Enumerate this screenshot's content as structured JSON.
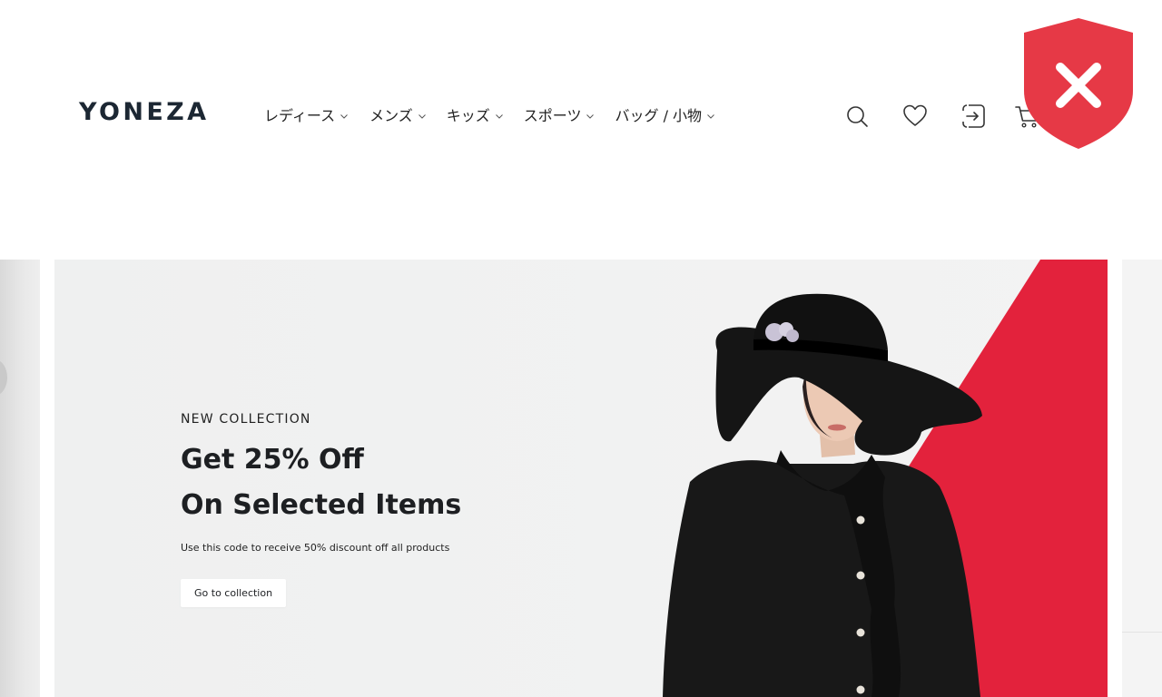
{
  "brand": {
    "logo_text": "YONEZA"
  },
  "nav": {
    "items": [
      {
        "label": "レディース"
      },
      {
        "label": "メンズ"
      },
      {
        "label": "キッズ"
      },
      {
        "label": "スポーツ"
      },
      {
        "label": "バッグ / 小物"
      }
    ]
  },
  "header_icons": [
    "search-icon",
    "heart-icon",
    "login-icon",
    "cart-icon"
  ],
  "overlay": {
    "icon": "shield-close-icon",
    "color": "#e63946"
  },
  "hero": {
    "eyebrow": "NEW COLLECTION",
    "headline_line1": "Get 25% Off",
    "headline_line2": "On Selected Items",
    "subtext": "Use this code to receive 50% discount off all products",
    "cta_label": "Go to collection",
    "accent_color": "#e3223c"
  }
}
